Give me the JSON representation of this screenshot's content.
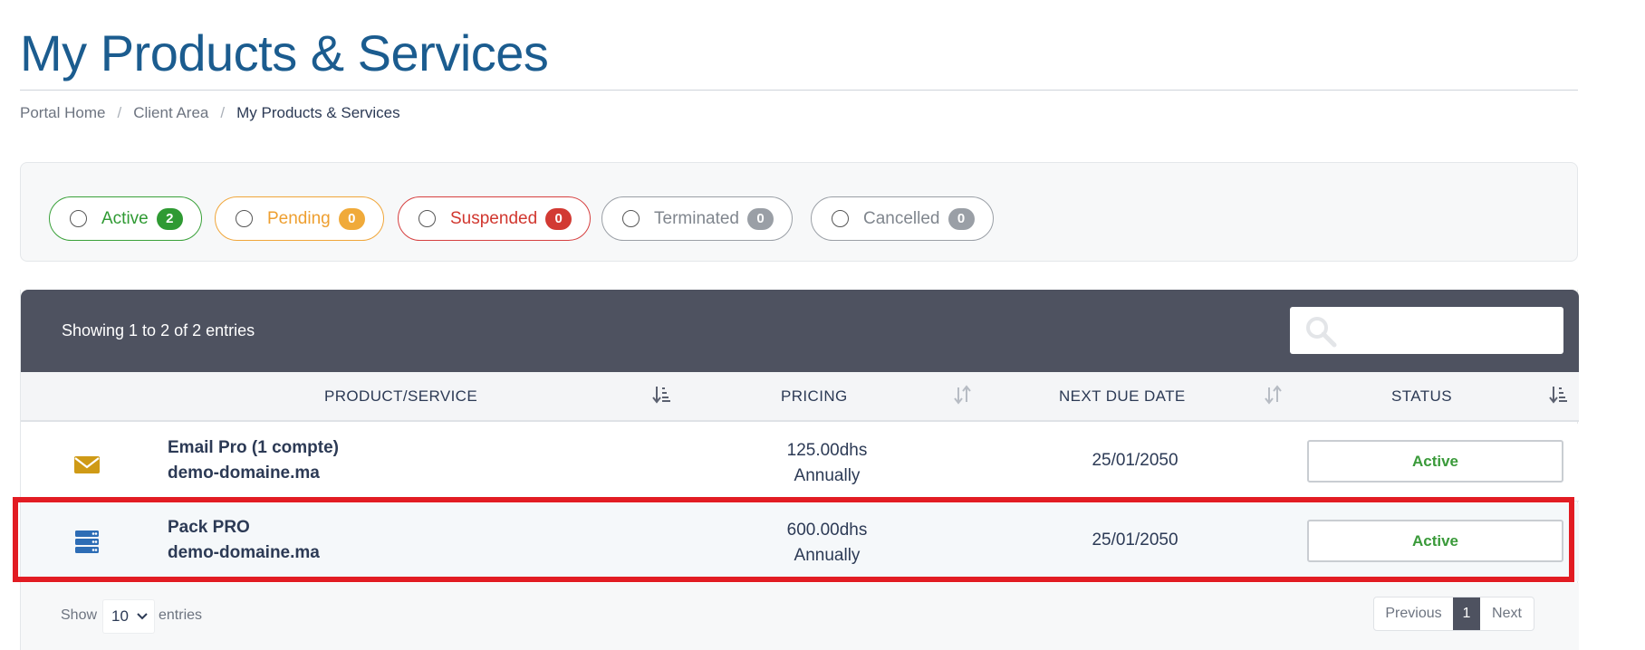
{
  "page": {
    "title": "My Products & Services"
  },
  "breadcrumb": {
    "home": "Portal Home",
    "separator": "/",
    "client_area": "Client Area",
    "current": "My Products & Services"
  },
  "filters": [
    {
      "label": "Active",
      "count": "2"
    },
    {
      "label": "Pending",
      "count": "0"
    },
    {
      "label": "Suspended",
      "count": "0"
    },
    {
      "label": "Terminated",
      "count": "0"
    },
    {
      "label": "Cancelled",
      "count": "0"
    }
  ],
  "table": {
    "showing": "Showing 1 to 2 of 2 entries",
    "search_value": "",
    "columns": {
      "product": "PRODUCT/SERVICE",
      "pricing": "PRICING",
      "due": "NEXT DUE DATE",
      "status": "STATUS"
    },
    "rows": [
      {
        "icon": "envelope-icon",
        "name": "Email Pro (1 compte)",
        "domain": "demo-domaine.ma",
        "price": "125.00dhs",
        "cycle": "Annually",
        "due": "25/01/2050",
        "status": "Active",
        "highlighted": false
      },
      {
        "icon": "server-icon",
        "name": "Pack PRO",
        "domain": "demo-domaine.ma",
        "price": "600.00dhs",
        "cycle": "Annually",
        "due": "25/01/2050",
        "status": "Active",
        "highlighted": true
      }
    ],
    "footer": {
      "show": "Show",
      "length": "10",
      "entries": "entries",
      "previous": "Previous",
      "page": "1",
      "next": "Next"
    }
  },
  "colors": {
    "title": "#1b5c8f",
    "header_bar": "#4e5260",
    "active": "#2f9a33",
    "pending": "#f0aa3a",
    "suspended": "#d23a33",
    "neutral": "#9a9fa6",
    "highlight": "#e21c23",
    "envelope_icon": "#cf9a16",
    "server_icon": "#2d6db5"
  }
}
